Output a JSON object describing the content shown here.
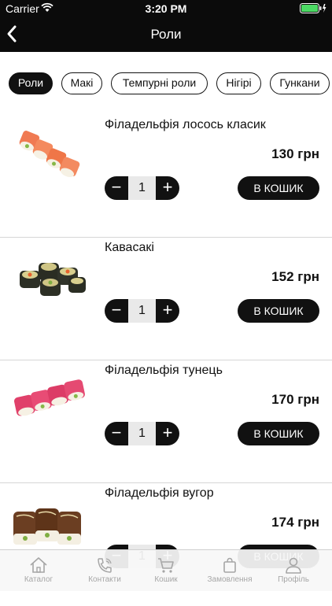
{
  "status_bar": {
    "carrier": "Carrier",
    "time": "3:20 PM"
  },
  "header": {
    "title": "Роли"
  },
  "categories": [
    {
      "label": "Роли",
      "active": true
    },
    {
      "label": "Макі",
      "active": false
    },
    {
      "label": "Темпурні роли",
      "active": false
    },
    {
      "label": "Нігірі",
      "active": false
    },
    {
      "label": "Гункани",
      "active": false
    }
  ],
  "products": [
    {
      "name": "Філадельфія лосось класик",
      "price": "130 грн",
      "quantity": "1",
      "add_label": "В КОШИК"
    },
    {
      "name": "Кавасакі",
      "price": "152 грн",
      "quantity": "1",
      "add_label": "В КОШИК"
    },
    {
      "name": "Філадельфія тунець",
      "price": "170 грн",
      "quantity": "1",
      "add_label": "В КОШИК"
    },
    {
      "name": "Філадельфія вугор",
      "price": "174 грн",
      "quantity": "1",
      "add_label": "В КОШИК"
    }
  ],
  "stepper": {
    "minus": "−",
    "plus": "+"
  },
  "tab_bar": [
    {
      "label": "Каталог",
      "icon": "home-icon"
    },
    {
      "label": "Контакти",
      "icon": "phone-icon"
    },
    {
      "label": "Кошик",
      "icon": "cart-icon"
    },
    {
      "label": "Замовлення",
      "icon": "bag-icon"
    },
    {
      "label": "Профіль",
      "icon": "user-icon"
    }
  ],
  "colors": {
    "bar": "#0b0b0b",
    "accent": "#111111",
    "battery": "#4cd964",
    "inactive_tab": "#a6a6a6"
  }
}
